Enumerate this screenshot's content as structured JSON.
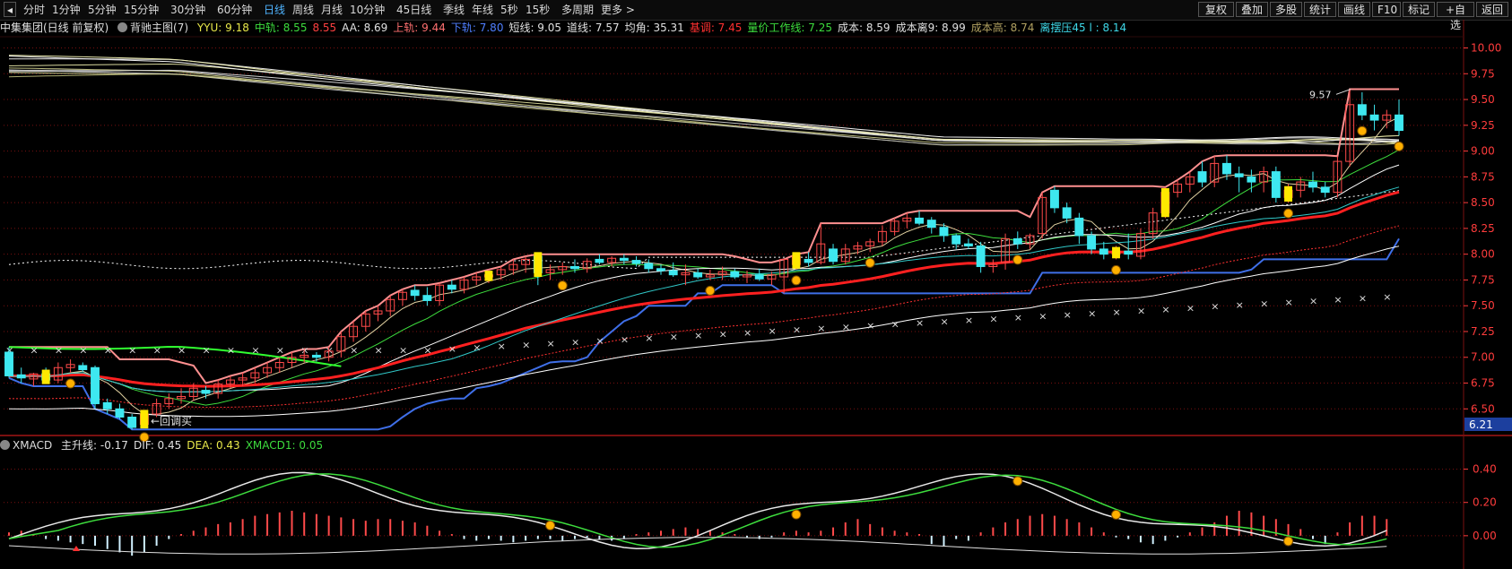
{
  "toolbar": {
    "nav_left_icon": "nav-left-icon",
    "periods": [
      {
        "label": "分时",
        "active": false
      },
      {
        "label": "1分钟",
        "active": false
      },
      {
        "label": "5分钟",
        "active": false
      },
      {
        "label": "15分钟",
        "active": false
      },
      {
        "label": "30分钟",
        "active": false
      },
      {
        "label": "60分钟",
        "active": false
      },
      {
        "label": "日线",
        "active": true
      },
      {
        "label": "周线",
        "active": false
      },
      {
        "label": "月线",
        "active": false
      },
      {
        "label": "10分钟",
        "active": false
      },
      {
        "label": "45日线",
        "active": false
      },
      {
        "label": "季线",
        "active": false
      },
      {
        "label": "年线",
        "active": false
      },
      {
        "label": "5秒",
        "active": false
      },
      {
        "label": "15秒",
        "active": false
      },
      {
        "label": "多周期",
        "active": false
      },
      {
        "label": "更多 >",
        "active": false
      }
    ],
    "actions": [
      "复权",
      "叠加",
      "多股",
      "统计",
      "画线",
      "F10",
      "标记",
      "+自选",
      "返回"
    ]
  },
  "main_info": {
    "stock": "中集集团(日线 前复权)",
    "indicator": "背驰主图(7)",
    "values": [
      {
        "text": "YYU: 9.18",
        "color": "#e8e84a"
      },
      {
        "text": "中轨: 8.55",
        "color": "#3ddc3d"
      },
      {
        "text": "8.55",
        "color": "#ff4040"
      },
      {
        "text": "AA: 8.69",
        "color": "#e0e0e0"
      },
      {
        "text": "上轨: 9.44",
        "color": "#ff7070"
      },
      {
        "text": "下轨: 7.80",
        "color": "#4f7fff"
      },
      {
        "text": "短线: 9.05",
        "color": "#e0e0e0"
      },
      {
        "text": "道线: 7.57",
        "color": "#e0e0e0"
      },
      {
        "text": "均角: 35.31",
        "color": "#e0e0e0"
      },
      {
        "text": "基调: 7.45",
        "color": "#ff3030"
      },
      {
        "text": "量价工作线: 7.25",
        "color": "#3ddc3d"
      },
      {
        "text": "成本: 8.59",
        "color": "#e0e0e0"
      },
      {
        "text": "成本离9: 8.99",
        "color": "#e0e0e0"
      },
      {
        "text": "成本高: 8.74",
        "color": "#b0a060"
      },
      {
        "text": "离摆压45 l : 8.14",
        "color": "#3ed8e8"
      }
    ]
  },
  "price_axis": [
    "10.00",
    "9.75",
    "9.50",
    "9.25",
    "9.00",
    "8.75",
    "8.50",
    "8.25",
    "8.00",
    "7.75",
    "7.50",
    "7.25",
    "7.00",
    "6.75",
    "6.50"
  ],
  "price_axis_min_label": "6.21",
  "annotations": {
    "high_label": "9.57",
    "buy_label": "回调买"
  },
  "macd_info": {
    "name": "XMACD",
    "values": [
      {
        "text": "主升线: -0.17",
        "color": "#e0e0e0"
      },
      {
        "text": "DIF: 0.45",
        "color": "#e0e0e0"
      },
      {
        "text": "DEA: 0.43",
        "color": "#e8e84a"
      },
      {
        "text": "XMACD1: 0.05",
        "color": "#3ddc3d"
      }
    ]
  },
  "macd_axis": [
    "0.40",
    "0.20",
    "0.00"
  ],
  "colors": {
    "up": "#ff4a4a",
    "down": "#3ee8f0",
    "grid": "#7a1010",
    "axis_text": "#ff3c3c",
    "buy_dot": "#ffb000",
    "ma_mid": "#ff2020",
    "lower_band": "#3f6fe8"
  },
  "chart_data": [
    {
      "type": "candlestick",
      "title": "中集集团(日线 前复权)",
      "ylim": [
        6.21,
        10.1
      ],
      "candles": [
        {
          "o": 7.05,
          "h": 7.1,
          "l": 6.8,
          "c": 6.82
        },
        {
          "o": 6.83,
          "h": 6.9,
          "l": 6.75,
          "c": 6.8
        },
        {
          "o": 6.79,
          "h": 6.85,
          "l": 6.72,
          "c": 6.84
        },
        {
          "o": 6.84,
          "h": 6.9,
          "l": 6.75,
          "c": 6.78
        },
        {
          "o": 6.78,
          "h": 6.95,
          "l": 6.75,
          "c": 6.9
        },
        {
          "o": 6.9,
          "h": 6.98,
          "l": 6.85,
          "c": 6.93
        },
        {
          "o": 6.92,
          "h": 6.95,
          "l": 6.86,
          "c": 6.88
        },
        {
          "o": 6.9,
          "h": 6.92,
          "l": 6.5,
          "c": 6.55
        },
        {
          "o": 6.56,
          "h": 6.6,
          "l": 6.45,
          "c": 6.5
        },
        {
          "o": 6.5,
          "h": 6.55,
          "l": 6.4,
          "c": 6.42
        },
        {
          "o": 6.42,
          "h": 6.45,
          "l": 6.3,
          "c": 6.32
        },
        {
          "o": 6.35,
          "h": 6.48,
          "l": 6.33,
          "c": 6.45
        },
        {
          "o": 6.45,
          "h": 6.6,
          "l": 6.42,
          "c": 6.55
        },
        {
          "o": 6.55,
          "h": 6.65,
          "l": 6.5,
          "c": 6.6
        },
        {
          "o": 6.6,
          "h": 6.7,
          "l": 6.55,
          "c": 6.62
        },
        {
          "o": 6.62,
          "h": 6.75,
          "l": 6.58,
          "c": 6.7
        },
        {
          "o": 6.68,
          "h": 6.72,
          "l": 6.6,
          "c": 6.65
        },
        {
          "o": 6.65,
          "h": 6.78,
          "l": 6.6,
          "c": 6.74
        },
        {
          "o": 6.74,
          "h": 6.82,
          "l": 6.7,
          "c": 6.78
        },
        {
          "o": 6.78,
          "h": 6.85,
          "l": 6.72,
          "c": 6.8
        },
        {
          "o": 6.8,
          "h": 6.9,
          "l": 6.75,
          "c": 6.85
        },
        {
          "o": 6.85,
          "h": 6.95,
          "l": 6.8,
          "c": 6.9
        },
        {
          "o": 6.9,
          "h": 7.0,
          "l": 6.85,
          "c": 6.95
        },
        {
          "o": 6.95,
          "h": 7.05,
          "l": 6.9,
          "c": 7.0
        },
        {
          "o": 7.0,
          "h": 7.08,
          "l": 6.95,
          "c": 7.02
        },
        {
          "o": 7.02,
          "h": 7.05,
          "l": 6.96,
          "c": 7.0
        },
        {
          "o": 7.0,
          "h": 7.1,
          "l": 6.96,
          "c": 7.06
        },
        {
          "o": 7.06,
          "h": 7.25,
          "l": 7.0,
          "c": 7.2
        },
        {
          "o": 7.2,
          "h": 7.35,
          "l": 7.15,
          "c": 7.3
        },
        {
          "o": 7.3,
          "h": 7.45,
          "l": 7.25,
          "c": 7.42
        },
        {
          "o": 7.42,
          "h": 7.5,
          "l": 7.35,
          "c": 7.45
        },
        {
          "o": 7.45,
          "h": 7.6,
          "l": 7.4,
          "c": 7.56
        },
        {
          "o": 7.56,
          "h": 7.66,
          "l": 7.5,
          "c": 7.63
        },
        {
          "o": 7.65,
          "h": 7.7,
          "l": 7.55,
          "c": 7.6
        },
        {
          "o": 7.6,
          "h": 7.68,
          "l": 7.5,
          "c": 7.55
        },
        {
          "o": 7.55,
          "h": 7.72,
          "l": 7.5,
          "c": 7.7
        },
        {
          "o": 7.7,
          "h": 7.75,
          "l": 7.62,
          "c": 7.66
        },
        {
          "o": 7.66,
          "h": 7.78,
          "l": 7.62,
          "c": 7.75
        },
        {
          "o": 7.75,
          "h": 7.82,
          "l": 7.7,
          "c": 7.78
        },
        {
          "o": 7.78,
          "h": 7.85,
          "l": 7.72,
          "c": 7.8
        },
        {
          "o": 7.8,
          "h": 7.88,
          "l": 7.75,
          "c": 7.85
        },
        {
          "o": 7.85,
          "h": 7.95,
          "l": 7.8,
          "c": 7.9
        },
        {
          "o": 7.9,
          "h": 7.98,
          "l": 7.82,
          "c": 7.95
        },
        {
          "o": 7.98,
          "h": 8.0,
          "l": 7.7,
          "c": 7.82
        },
        {
          "o": 7.82,
          "h": 7.9,
          "l": 7.75,
          "c": 7.85
        },
        {
          "o": 7.85,
          "h": 7.92,
          "l": 7.8,
          "c": 7.88
        },
        {
          "o": 7.88,
          "h": 7.95,
          "l": 7.82,
          "c": 7.86
        },
        {
          "o": 7.86,
          "h": 7.96,
          "l": 7.82,
          "c": 7.93
        },
        {
          "o": 7.95,
          "h": 8.0,
          "l": 7.9,
          "c": 7.92
        },
        {
          "o": 7.92,
          "h": 7.98,
          "l": 7.88,
          "c": 7.96
        },
        {
          "o": 7.96,
          "h": 8.0,
          "l": 7.9,
          "c": 7.94
        },
        {
          "o": 7.94,
          "h": 7.98,
          "l": 7.88,
          "c": 7.91
        },
        {
          "o": 7.91,
          "h": 7.95,
          "l": 7.82,
          "c": 7.86
        },
        {
          "o": 7.86,
          "h": 7.9,
          "l": 7.8,
          "c": 7.84
        },
        {
          "o": 7.84,
          "h": 7.92,
          "l": 7.78,
          "c": 7.8
        },
        {
          "o": 7.8,
          "h": 7.9,
          "l": 7.7,
          "c": 7.82
        },
        {
          "o": 7.82,
          "h": 7.86,
          "l": 7.76,
          "c": 7.78
        },
        {
          "o": 7.78,
          "h": 7.85,
          "l": 7.75,
          "c": 7.8
        },
        {
          "o": 7.8,
          "h": 7.88,
          "l": 7.75,
          "c": 7.83
        },
        {
          "o": 7.83,
          "h": 7.86,
          "l": 7.76,
          "c": 7.78
        },
        {
          "o": 7.78,
          "h": 7.84,
          "l": 7.72,
          "c": 7.8
        },
        {
          "o": 7.8,
          "h": 7.86,
          "l": 7.74,
          "c": 7.76
        },
        {
          "o": 7.76,
          "h": 7.83,
          "l": 7.7,
          "c": 7.8
        },
        {
          "o": 7.78,
          "h": 7.95,
          "l": 7.62,
          "c": 7.95
        },
        {
          "o": 7.9,
          "h": 8.0,
          "l": 7.85,
          "c": 7.98
        },
        {
          "o": 7.95,
          "h": 8.02,
          "l": 7.88,
          "c": 7.92
        },
        {
          "o": 7.92,
          "h": 8.3,
          "l": 7.9,
          "c": 8.1
        },
        {
          "o": 8.05,
          "h": 8.1,
          "l": 7.9,
          "c": 7.93
        },
        {
          "o": 7.93,
          "h": 8.1,
          "l": 7.9,
          "c": 8.05
        },
        {
          "o": 8.05,
          "h": 8.12,
          "l": 8.0,
          "c": 8.08
        },
        {
          "o": 8.08,
          "h": 8.15,
          "l": 8.02,
          "c": 8.12
        },
        {
          "o": 8.12,
          "h": 8.28,
          "l": 8.08,
          "c": 8.22
        },
        {
          "o": 8.22,
          "h": 8.35,
          "l": 8.18,
          "c": 8.32
        },
        {
          "o": 8.32,
          "h": 8.4,
          "l": 8.25,
          "c": 8.35
        },
        {
          "o": 8.35,
          "h": 8.42,
          "l": 8.28,
          "c": 8.3
        },
        {
          "o": 8.33,
          "h": 8.36,
          "l": 8.2,
          "c": 8.26
        },
        {
          "o": 8.26,
          "h": 8.3,
          "l": 8.12,
          "c": 8.18
        },
        {
          "o": 8.18,
          "h": 8.2,
          "l": 8.05,
          "c": 8.1
        },
        {
          "o": 8.1,
          "h": 8.15,
          "l": 8.05,
          "c": 8.08
        },
        {
          "o": 8.08,
          "h": 8.12,
          "l": 7.82,
          "c": 7.88
        },
        {
          "o": 7.88,
          "h": 7.95,
          "l": 7.82,
          "c": 7.9
        },
        {
          "o": 7.92,
          "h": 8.2,
          "l": 7.85,
          "c": 8.15
        },
        {
          "o": 8.15,
          "h": 8.22,
          "l": 8.05,
          "c": 8.1
        },
        {
          "o": 8.1,
          "h": 8.2,
          "l": 8.05,
          "c": 8.18
        },
        {
          "o": 8.2,
          "h": 8.6,
          "l": 8.15,
          "c": 8.55
        },
        {
          "o": 8.62,
          "h": 8.66,
          "l": 8.4,
          "c": 8.45
        },
        {
          "o": 8.45,
          "h": 8.5,
          "l": 8.3,
          "c": 8.35
        },
        {
          "o": 8.35,
          "h": 8.4,
          "l": 8.1,
          "c": 8.18
        },
        {
          "o": 8.18,
          "h": 8.22,
          "l": 8.0,
          "c": 8.05
        },
        {
          "o": 8.05,
          "h": 8.12,
          "l": 7.95,
          "c": 8.0
        },
        {
          "o": 8.0,
          "h": 8.08,
          "l": 7.95,
          "c": 8.03
        },
        {
          "o": 8.03,
          "h": 8.2,
          "l": 7.95,
          "c": 8.0
        },
        {
          "o": 7.98,
          "h": 8.25,
          "l": 7.95,
          "c": 8.2
        },
        {
          "o": 8.2,
          "h": 8.45,
          "l": 8.15,
          "c": 8.4
        },
        {
          "o": 8.4,
          "h": 8.65,
          "l": 8.35,
          "c": 8.6
        },
        {
          "o": 8.6,
          "h": 8.72,
          "l": 8.55,
          "c": 8.68
        },
        {
          "o": 8.68,
          "h": 8.8,
          "l": 8.6,
          "c": 8.75
        },
        {
          "o": 8.8,
          "h": 8.9,
          "l": 8.65,
          "c": 8.7
        },
        {
          "o": 8.7,
          "h": 8.95,
          "l": 8.65,
          "c": 8.88
        },
        {
          "o": 8.88,
          "h": 8.96,
          "l": 8.72,
          "c": 8.78
        },
        {
          "o": 8.78,
          "h": 8.85,
          "l": 8.6,
          "c": 8.75
        },
        {
          "o": 8.75,
          "h": 8.82,
          "l": 8.6,
          "c": 8.7
        },
        {
          "o": 8.7,
          "h": 8.85,
          "l": 8.6,
          "c": 8.8
        },
        {
          "o": 8.8,
          "h": 8.85,
          "l": 8.5,
          "c": 8.55
        },
        {
          "o": 8.55,
          "h": 8.68,
          "l": 8.5,
          "c": 8.62
        },
        {
          "o": 8.62,
          "h": 8.75,
          "l": 8.55,
          "c": 8.7
        },
        {
          "o": 8.7,
          "h": 8.8,
          "l": 8.6,
          "c": 8.65
        },
        {
          "o": 8.65,
          "h": 8.7,
          "l": 8.55,
          "c": 8.6
        },
        {
          "o": 8.6,
          "h": 8.95,
          "l": 8.55,
          "c": 8.9
        },
        {
          "o": 8.9,
          "h": 9.6,
          "l": 8.85,
          "c": 9.45
        },
        {
          "o": 9.45,
          "h": 9.57,
          "l": 9.3,
          "c": 9.35
        },
        {
          "o": 9.35,
          "h": 9.45,
          "l": 9.2,
          "c": 9.3
        },
        {
          "o": 9.3,
          "h": 9.4,
          "l": 9.22,
          "c": 9.35
        },
        {
          "o": 9.35,
          "h": 9.5,
          "l": 9.15,
          "c": 9.2
        }
      ]
    },
    {
      "type": "bar",
      "title": "XMACD",
      "ylim": [
        -0.2,
        0.5
      ],
      "values": [
        0.02,
        0.03,
        0.01,
        -0.02,
        -0.03,
        -0.04,
        -0.05,
        -0.06,
        -0.08,
        -0.1,
        -0.12,
        -0.1,
        -0.06,
        -0.02,
        0.01,
        0.03,
        0.05,
        0.07,
        0.08,
        0.1,
        0.12,
        0.13,
        0.14,
        0.15,
        0.14,
        0.13,
        0.12,
        0.11,
        0.1,
        0.09,
        0.1,
        0.1,
        0.09,
        0.08,
        0.06,
        0.03,
        0.01,
        -0.02,
        -0.03,
        -0.02,
        -0.03,
        -0.04,
        -0.03,
        -0.02,
        -0.02,
        -0.03,
        -0.02,
        -0.01,
        -0.02,
        -0.03,
        -0.02,
        0.01,
        0.02,
        0.03,
        0.04,
        0.05,
        0.04,
        0.03,
        0.02,
        0.01,
        -0.01,
        -0.02,
        -0.01,
        0.02,
        0.03,
        0.02,
        0.03,
        0.05,
        0.08,
        0.1,
        0.07,
        0.05,
        0.03,
        0.02,
        0.01,
        -0.05,
        -0.06,
        -0.02,
        -0.03,
        0.02,
        0.05,
        0.08,
        0.1,
        0.12,
        0.13,
        0.12,
        0.1,
        0.08,
        0.05,
        0.02,
        -0.01,
        -0.02,
        -0.04,
        -0.05,
        -0.03,
        -0.01,
        0.02,
        0.05,
        0.08,
        0.12,
        0.15,
        0.14,
        0.12,
        0.1,
        0.07,
        0.04,
        -0.02,
        -0.05,
        0.02,
        0.08,
        0.12,
        0.12,
        0.1
      ]
    }
  ]
}
